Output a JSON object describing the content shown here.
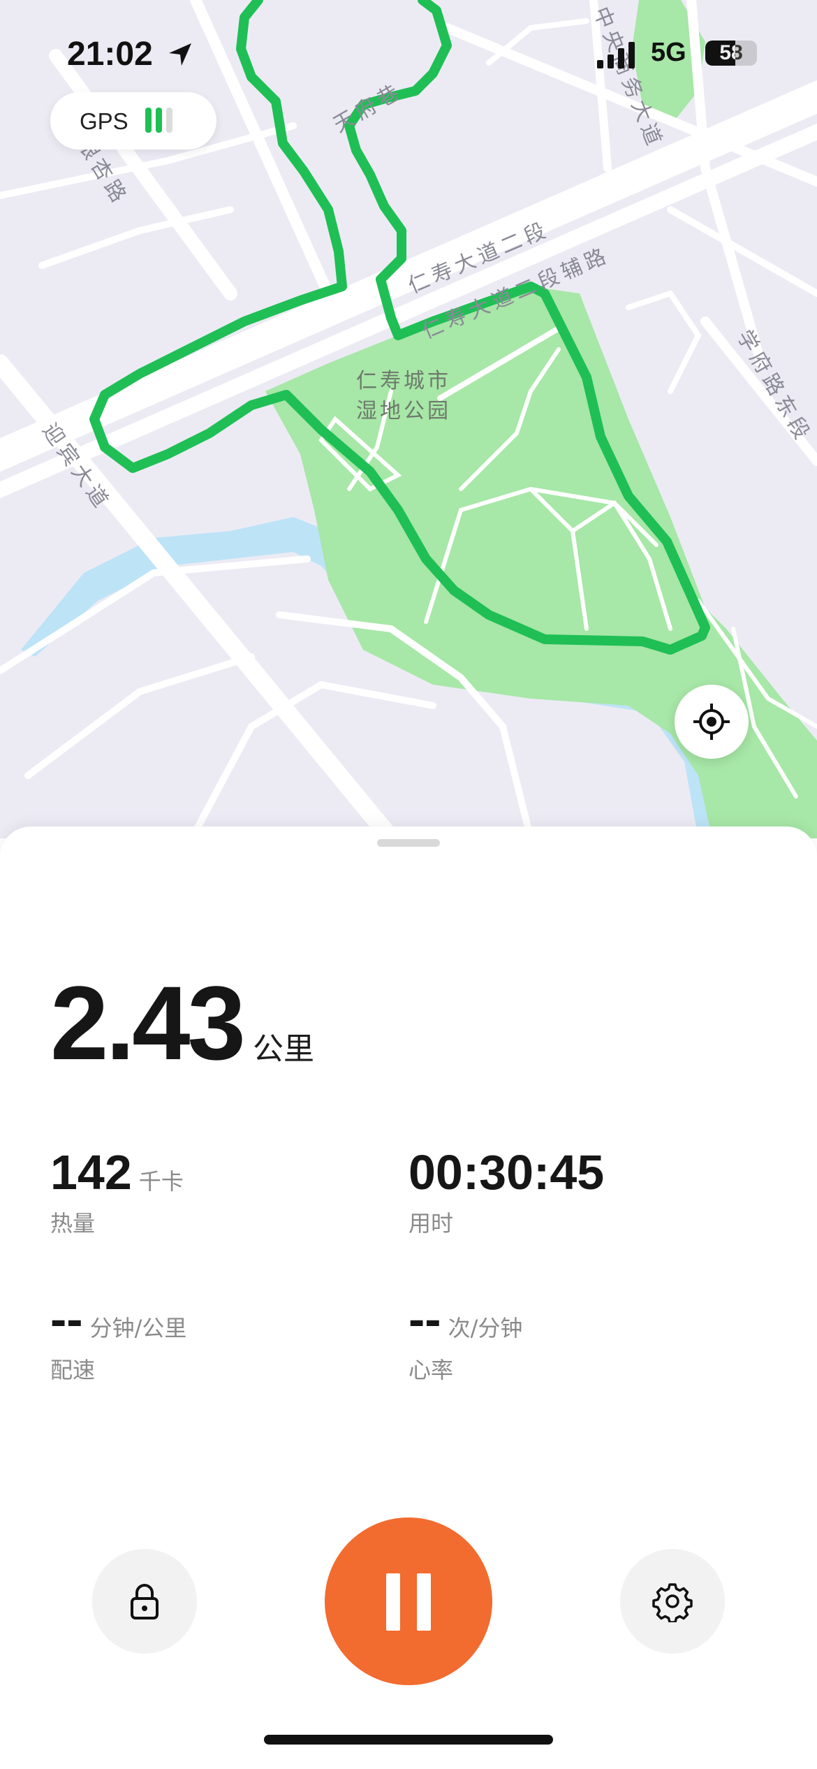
{
  "status_bar": {
    "time": "21:02",
    "network": "5G",
    "battery_level": "58",
    "battery_fraction": 0.58
  },
  "gps": {
    "label": "GPS",
    "signal_bars_active": 2,
    "signal_bars_total": 3,
    "active_color": "#1fbf55",
    "inactive_color": "#dcdcdc"
  },
  "map": {
    "road_labels": [
      "仁寿大道二段",
      "仁寿大道二段辅路",
      "迎宾大道",
      "学府路东段",
      "中央商务大道",
      "银杏路",
      "天府巷"
    ],
    "park_name": [
      "仁寿城市",
      "湿地公园"
    ],
    "route_color": "#1fbf55",
    "park_color": "#a7e7a7",
    "water_color": "#bde3f7"
  },
  "run": {
    "distance": "2.43",
    "distance_unit": "公里",
    "calories": "142",
    "calories_unit": "千卡",
    "calories_label": "热量",
    "duration": "00:30:45",
    "duration_label": "用时",
    "pace": "--",
    "pace_unit": "分钟/公里",
    "pace_label": "配速",
    "heart_rate": "--",
    "heart_rate_unit": "次/分钟",
    "heart_rate_label": "心率"
  },
  "controls": {
    "lock_icon": "lock-icon",
    "pause_icon": "pause-icon",
    "settings_icon": "gear-icon",
    "pause_color": "#f26b2f"
  }
}
